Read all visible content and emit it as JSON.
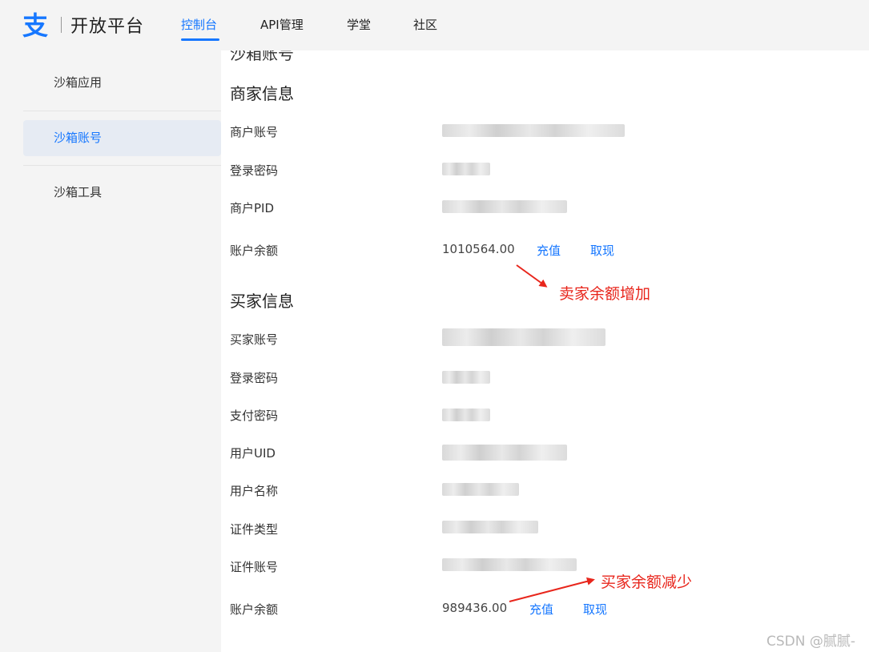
{
  "header": {
    "logo_text": "开放平台",
    "nav": [
      "控制台",
      "API管理",
      "学堂",
      "社区"
    ],
    "active_nav": "控制台"
  },
  "sidebar": {
    "items": [
      {
        "label": "沙箱应用"
      },
      {
        "label": "沙箱账号"
      },
      {
        "label": "沙箱工具"
      }
    ],
    "active": "沙箱账号"
  },
  "merchant": {
    "title": "商家信息",
    "fields": [
      "商户账号",
      "登录密码",
      "商户PID",
      "账户余额"
    ],
    "balance": "1010564.00",
    "recharge": "充值",
    "withdraw": "取现"
  },
  "buyer": {
    "title": "买家信息",
    "fields": [
      "买家账号",
      "登录密码",
      "支付密码",
      "用户UID",
      "用户名称",
      "证件类型",
      "证件账号",
      "账户余额"
    ],
    "balance": "989436.00",
    "recharge": "充值",
    "withdraw": "取现"
  },
  "annotations": {
    "seller_up": "卖家余额增加",
    "buyer_down": "买家余额减少"
  },
  "colors": {
    "accent": "#1677ff",
    "annotation": "#e8261c"
  },
  "watermark": "CSDN @腻腻-"
}
